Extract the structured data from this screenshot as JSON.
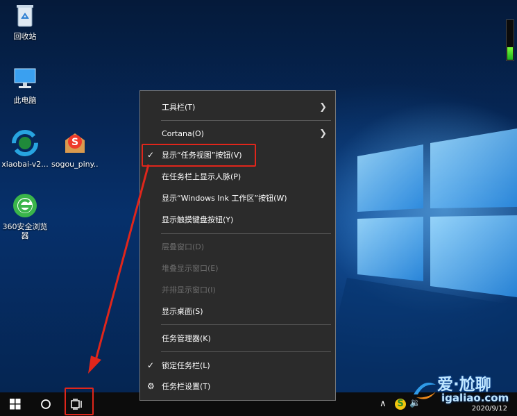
{
  "desktop": {
    "icons": [
      {
        "label": "回收站",
        "icon": "recycle-bin-icon"
      },
      {
        "label": "此电脑",
        "icon": "computer-icon"
      },
      {
        "label": "xiaobai-v2...",
        "icon": "xiaobai-app-icon"
      },
      {
        "label": "sogou_piny...",
        "icon": "sogou-pinyin-icon"
      },
      {
        "label": "360安全浏览",
        "label2": "器",
        "icon": "browser-360-icon"
      }
    ]
  },
  "context_menu": {
    "items": [
      {
        "label": "工具栏(T)",
        "has_submenu": true,
        "checked": false,
        "enabled": true
      },
      {
        "label": "Cortana(O)",
        "has_submenu": true,
        "checked": false,
        "enabled": true
      },
      {
        "label": "显示“任务视图”按钮(V)",
        "has_submenu": false,
        "checked": true,
        "enabled": true,
        "highlighted": true
      },
      {
        "label": "在任务栏上显示人脉(P)",
        "has_submenu": false,
        "checked": false,
        "enabled": true
      },
      {
        "label": "显示“Windows Ink 工作区”按钮(W)",
        "has_submenu": false,
        "checked": false,
        "enabled": true
      },
      {
        "label": "显示触摸键盘按钮(Y)",
        "has_submenu": false,
        "checked": false,
        "enabled": true
      },
      {
        "label": "层叠窗口(D)",
        "has_submenu": false,
        "checked": false,
        "enabled": false
      },
      {
        "label": "堆叠显示窗口(E)",
        "has_submenu": false,
        "checked": false,
        "enabled": false
      },
      {
        "label": "并排显示窗口(I)",
        "has_submenu": false,
        "checked": false,
        "enabled": false
      },
      {
        "label": "显示桌面(S)",
        "has_submenu": false,
        "checked": false,
        "enabled": true
      },
      {
        "label": "任务管理器(K)",
        "has_submenu": false,
        "checked": false,
        "enabled": true
      },
      {
        "label": "锁定任务栏(L)",
        "has_submenu": false,
        "checked": true,
        "enabled": true
      },
      {
        "label": "任务栏设置(T)",
        "has_submenu": false,
        "checked": false,
        "enabled": true,
        "icon": "gear-icon"
      }
    ]
  },
  "taskbar": {
    "tray": {
      "date": "2020/9/12"
    }
  },
  "watermark": {
    "line1": "爱·尬聊",
    "line2": "igaliao.com"
  },
  "colors": {
    "annotation": "#e0261b",
    "menu_bg": "#2b2b2b",
    "taskbar_bg": "#0c0c0c"
  }
}
